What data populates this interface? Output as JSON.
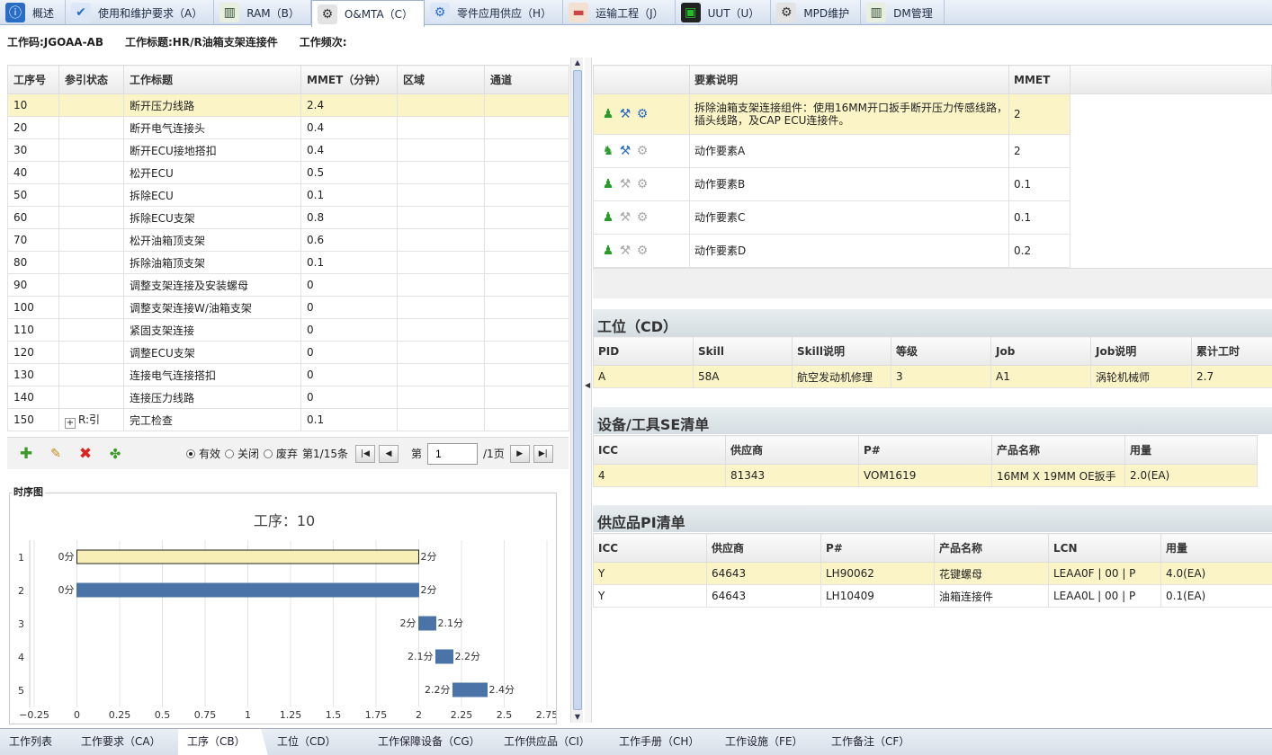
{
  "top_tabs": [
    {
      "label": "概述",
      "icon": "info-icon"
    },
    {
      "label": "使用和维护要求（A）",
      "icon": "checklist-icon"
    },
    {
      "label": "RAM（B）",
      "icon": "chart-icon"
    },
    {
      "label": "O&MTA（C）",
      "icon": "worker-gear-icon"
    },
    {
      "label": "零件应用供应（H）",
      "icon": "gears-icon"
    },
    {
      "label": "运输工程（J）",
      "icon": "truck-icon"
    },
    {
      "label": "UUT（U）",
      "icon": "monitor-icon"
    },
    {
      "label": "MPD维护",
      "icon": "worker-gear-icon"
    },
    {
      "label": "DM管理",
      "icon": "chart-icon"
    }
  ],
  "work_info": {
    "code": "工作码:JGOAA-AB",
    "title": "工作标题:HR/R油箱支架连接件",
    "freq": "工作频次:"
  },
  "op_table": {
    "headers": [
      "工序号",
      "参引状态",
      "工作标题",
      "MMET（分钟）",
      "区域",
      "通道"
    ],
    "rows": [
      {
        "no": "10",
        "ref": "",
        "title": "断开压力线路",
        "mmet": "2.4"
      },
      {
        "no": "20",
        "ref": "",
        "title": "断开电气连接头",
        "mmet": "0.4"
      },
      {
        "no": "30",
        "ref": "",
        "title": "断开ECU接地搭扣",
        "mmet": "0.4"
      },
      {
        "no": "40",
        "ref": "",
        "title": "松开ECU",
        "mmet": "0.5"
      },
      {
        "no": "50",
        "ref": "",
        "title": "拆除ECU",
        "mmet": "0.1"
      },
      {
        "no": "60",
        "ref": "",
        "title": "拆除ECU支架",
        "mmet": "0.8"
      },
      {
        "no": "70",
        "ref": "",
        "title": "松开油箱顶支架",
        "mmet": "0.6"
      },
      {
        "no": "80",
        "ref": "",
        "title": "拆除油箱顶支架",
        "mmet": "0.1"
      },
      {
        "no": "90",
        "ref": "",
        "title": "调整支架连接及安装螺母",
        "mmet": "0"
      },
      {
        "no": "100",
        "ref": "",
        "title": "调整支架连接W/油箱支架",
        "mmet": "0"
      },
      {
        "no": "110",
        "ref": "",
        "title": "紧固支架连接",
        "mmet": "0"
      },
      {
        "no": "120",
        "ref": "",
        "title": "调整ECU支架",
        "mmet": "0"
      },
      {
        "no": "130",
        "ref": "",
        "title": "连接电气连接搭扣",
        "mmet": "0"
      },
      {
        "no": "140",
        "ref": "",
        "title": "连接压力线路",
        "mmet": "0"
      },
      {
        "no": "150",
        "ref": "R:引",
        "title": "完工检查",
        "mmet": "0.1"
      }
    ]
  },
  "toolbar": {
    "radios": [
      {
        "label": "有效",
        "checked": true
      },
      {
        "label": "关闭",
        "checked": false
      },
      {
        "label": "废弃",
        "checked": false
      }
    ],
    "record_info": "第1/15条",
    "page_prefix": "第",
    "page_value": "1",
    "page_suffix": "/1页"
  },
  "chart_label": "时序图",
  "chart_data": {
    "type": "bar",
    "title": "工序：10",
    "categories": [
      "1",
      "2",
      "3",
      "4",
      "5"
    ],
    "series": [
      {
        "start": [
          0,
          0,
          2,
          2.1,
          2.2
        ],
        "end": [
          2,
          2,
          2.1,
          2.2,
          2.4
        ]
      }
    ],
    "start_labels": [
      "0分",
      "0分",
      "2分",
      "2.1分",
      "2.2分"
    ],
    "end_labels": [
      "2分",
      "2分",
      "2.1分",
      "2.2分",
      "2.4分"
    ],
    "xlim": [
      -0.25,
      2.75
    ],
    "xticks": [
      "−0.25",
      "0",
      "0.25",
      "0.5",
      "0.75",
      "1",
      "1.25",
      "1.5",
      "1.75",
      "2",
      "2.25",
      "2.5",
      "2.75"
    ],
    "colors": {
      "first": "#f7efb5",
      "rest": "#4a73a8"
    }
  },
  "elements": {
    "headers": [
      "",
      "要素说明",
      "MMET"
    ],
    "rows": [
      {
        "icons": [
          "person-icon",
          "wrench-icon",
          "gear-icon"
        ],
        "desc_line1": "拆除油箱支架连接组件：使用16MM开口扳手断开压力传感线路，",
        "desc_line2": "插头线路，及CAP ECU连接件。",
        "mmet": "2"
      },
      {
        "icons": [
          "persons-icon",
          "wrench-icon",
          "gear-icon"
        ],
        "desc_line1": "动作要素A",
        "desc_line2": "",
        "mmet": "2"
      },
      {
        "icons": [
          "person-icon",
          "wrench-icon",
          "gear-icon"
        ],
        "desc_line1": "动作要素B",
        "desc_line2": "",
        "mmet": "0.1"
      },
      {
        "icons": [
          "person-icon",
          "wrench-icon",
          "gear-icon"
        ],
        "desc_line1": "动作要素C",
        "desc_line2": "",
        "mmet": "0.1"
      },
      {
        "icons": [
          "person-icon",
          "wrench-icon",
          "gear-icon"
        ],
        "desc_line1": "动作要素D",
        "desc_line2": "",
        "mmet": "0.2"
      }
    ]
  },
  "station": {
    "title": "工位（CD）",
    "headers": [
      "PID",
      "Skill",
      "Skill说明",
      "等级",
      "Job",
      "Job说明",
      "累计工时"
    ],
    "rows": [
      [
        "A",
        "58A",
        "航空发动机修理",
        "3",
        "A1",
        "涡轮机械师",
        "2.7"
      ]
    ]
  },
  "equipment": {
    "title": "设备/工具SE清单",
    "headers": [
      "ICC",
      "供应商",
      "P#",
      "产品名称",
      "用量"
    ],
    "rows": [
      [
        "4",
        "81343",
        "VOM1619",
        "16MM X 19MM OE扳手",
        "2.0(EA)"
      ]
    ]
  },
  "supply": {
    "title": "供应品PI清单",
    "headers": [
      "ICC",
      "供应商",
      "P#",
      "产品名称",
      "LCN",
      "用量"
    ],
    "rows": [
      [
        "Y",
        "64643",
        "LH90062",
        "花键螺母",
        "LEAA0F | 00 | P",
        "4.0(EA)"
      ],
      [
        "Y",
        "64643",
        "LH10409",
        "油箱连接件",
        "LEAA0L | 00 | P",
        "0.1(EA)"
      ]
    ]
  },
  "bottom_tabs": [
    "工作列表",
    "工作要求（CA）",
    "工序（CB）",
    "工位（CD）",
    "工作保障设备（CG）",
    "工作供应品（CI）",
    "工作手册（CH）",
    "工作设施（FE）",
    "工作备注（CF）"
  ]
}
